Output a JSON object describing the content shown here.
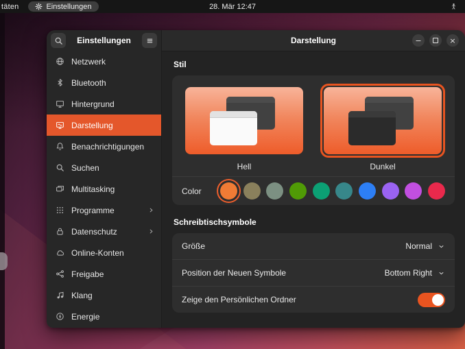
{
  "topbar": {
    "activities_label": "täten",
    "app_indicator": {
      "icon": "gear-icon",
      "label": "Einstellungen"
    },
    "clock": "28. Mär 12:47",
    "status_icon": "accessibility-status-icon"
  },
  "window": {
    "sidebar": {
      "title": "Einstellungen",
      "items": [
        {
          "id": "netzwerk",
          "label": "Netzwerk",
          "icon": "globe"
        },
        {
          "id": "bluetooth",
          "label": "Bluetooth",
          "icon": "bluetooth"
        },
        {
          "id": "hintergrund",
          "label": "Hintergrund",
          "icon": "monitor"
        },
        {
          "id": "darstellung",
          "label": "Darstellung",
          "icon": "appearance",
          "selected": true
        },
        {
          "id": "benachrichtigungen",
          "label": "Benachrichtigungen",
          "icon": "bell"
        },
        {
          "id": "suchen",
          "label": "Suchen",
          "icon": "search"
        },
        {
          "id": "multitasking",
          "label": "Multitasking",
          "icon": "multitasking"
        },
        {
          "id": "programme",
          "label": "Programme",
          "icon": "grid",
          "chevron": true
        },
        {
          "id": "datenschutz",
          "label": "Datenschutz",
          "icon": "lock",
          "chevron": true
        },
        {
          "id": "online-konten",
          "label": "Online-Konten",
          "icon": "cloud"
        },
        {
          "id": "freigabe",
          "label": "Freigabe",
          "icon": "share"
        },
        {
          "id": "klang",
          "label": "Klang",
          "icon": "note"
        },
        {
          "id": "energie",
          "label": "Energie",
          "icon": "power"
        }
      ]
    },
    "header": {
      "title": "Darstellung",
      "controls": [
        "minimize",
        "maximize",
        "close"
      ]
    },
    "style_section": {
      "title": "Stil",
      "themes": [
        {
          "id": "hell",
          "label": "Hell",
          "selected": false
        },
        {
          "id": "dunkel",
          "label": "Dunkel",
          "selected": true
        }
      ],
      "color_label": "Color",
      "accent_colors": [
        "#F07B35",
        "#8A805C",
        "#7C9082",
        "#509B06",
        "#0CA074",
        "#37878A",
        "#2D7FF5",
        "#9A63F2",
        "#C14FE0",
        "#E9294C"
      ],
      "selected_color_index": 0
    },
    "desktop_section": {
      "title": "Schreibtischsymbole",
      "rows": [
        {
          "label": "Größe",
          "value": "Normal",
          "control": "dropdown"
        },
        {
          "label": "Position der Neuen Symbole",
          "value": "Bottom Right",
          "control": "dropdown"
        },
        {
          "label": "Zeige den Persönlichen Ordner",
          "control": "toggle",
          "enabled": true
        }
      ]
    }
  },
  "colors": {
    "accent": "#E95420",
    "selected_row": "#E4572B"
  }
}
